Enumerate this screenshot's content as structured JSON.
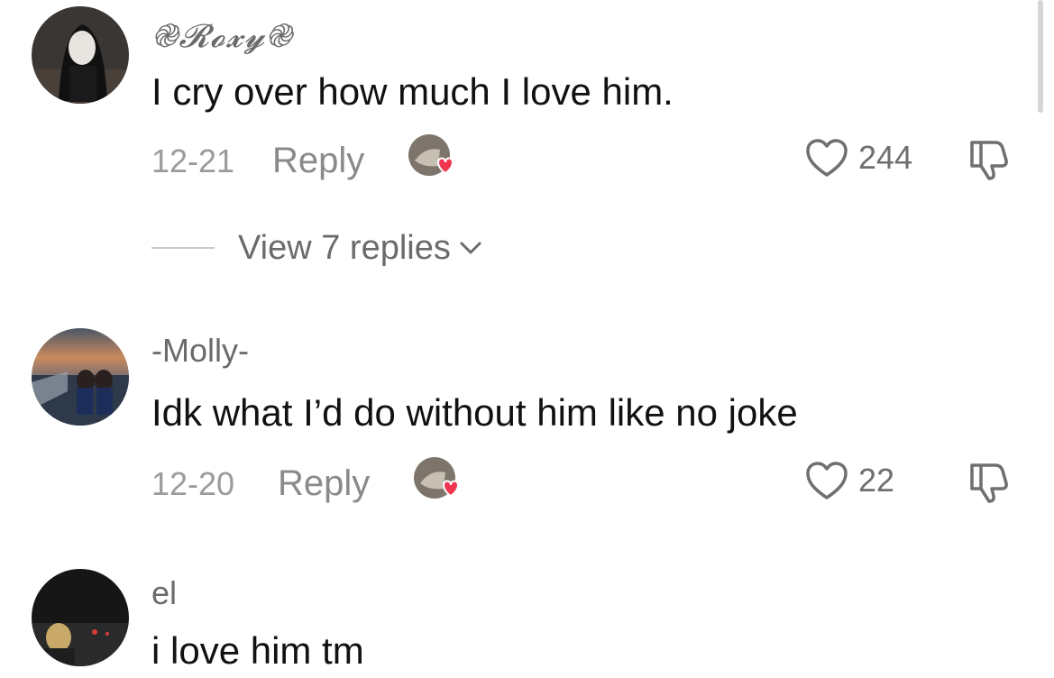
{
  "comments": [
    {
      "username": "֎𝓡𝓸𝔁𝔂֎",
      "text": "I cry over how much I love him.",
      "date": "12-21",
      "reply_label": "Reply",
      "likes": "244",
      "view_replies": "View 7 replies"
    },
    {
      "username": "-Molly-",
      "text": "Idk what I’d do without him like no joke",
      "date": "12-20",
      "reply_label": "Reply",
      "likes": "22"
    },
    {
      "username": "el",
      "text": "i love him tm"
    }
  ],
  "colors": {
    "liked_by_creator_heart": "#f0364f",
    "muted_text": "#9b9b9b",
    "body_text": "#111111"
  },
  "icons": [
    "heart-outline-icon",
    "thumbs-down-icon",
    "chevron-down-icon",
    "creator-heart-badge-icon"
  ]
}
